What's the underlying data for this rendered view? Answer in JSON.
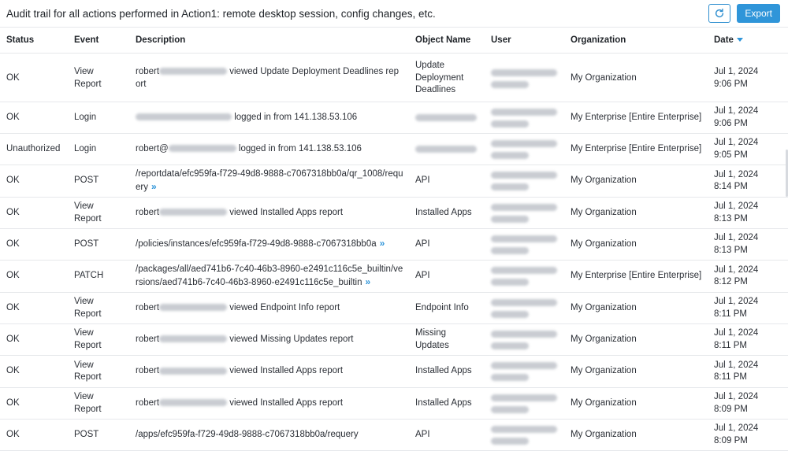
{
  "header": {
    "title": "Audit trail for all actions performed in Action1: remote desktop session, config changes, etc.",
    "export_label": "Export",
    "refresh_icon": "refresh-icon"
  },
  "columns": [
    "Status",
    "Event",
    "Description",
    "Object Name",
    "User",
    "Organization",
    "Date"
  ],
  "rows": [
    {
      "status": "OK",
      "event": [
        "View",
        "Report"
      ],
      "desc_pre": "robert",
      "desc_post": " viewed Update Deployment Deadlines report",
      "obj": [
        "Update",
        "Deployment",
        "Deadlines"
      ],
      "org": "My Organization",
      "date": [
        "Jul 1, 2024",
        "9:06 PM"
      ],
      "arrow": false
    },
    {
      "status": "OK",
      "event": [
        "Login"
      ],
      "desc_pre": "",
      "desc_post": " logged in from 141.138.53.106",
      "obj": [],
      "org": "My Enterprise [Entire Enterprise]",
      "date": [
        "Jul 1, 2024",
        "9:06 PM"
      ],
      "arrow": false
    },
    {
      "status": "Unauthorized",
      "event": [
        "Login"
      ],
      "desc_pre": "robert@",
      "desc_post": " logged in from 141.138.53.106",
      "obj": [],
      "org": "My Enterprise [Entire Enterprise]",
      "date": [
        "Jul 1, 2024",
        "9:05 PM"
      ],
      "arrow": false
    },
    {
      "status": "OK",
      "event": [
        "POST"
      ],
      "desc_pre": "/reportdata/efc959fa-f729-49d8-9888-c7067318bb0a/qr_1008/requery",
      "desc_post": "",
      "obj": [
        "API"
      ],
      "org": "My Organization",
      "date": [
        "Jul 1, 2024",
        "8:14 PM"
      ],
      "arrow": true
    },
    {
      "status": "OK",
      "event": [
        "View",
        "Report"
      ],
      "desc_pre": "robert",
      "desc_post": " viewed Installed Apps report",
      "obj": [
        "Installed Apps"
      ],
      "org": "My Organization",
      "date": [
        "Jul 1, 2024",
        "8:13 PM"
      ],
      "arrow": false
    },
    {
      "status": "OK",
      "event": [
        "POST"
      ],
      "desc_pre": "/policies/instances/efc959fa-f729-49d8-9888-c7067318bb0a",
      "desc_post": "",
      "obj": [
        "API"
      ],
      "org": "My Organization",
      "date": [
        "Jul 1, 2024",
        "8:13 PM"
      ],
      "arrow": true
    },
    {
      "status": "OK",
      "event": [
        "PATCH"
      ],
      "desc_pre": "/packages/all/aed741b6-7c40-46b3-8960-e2491c116c5e_builtin/versions/aed741b6-7c40-46b3-8960-e2491c116c5e_builtin",
      "desc_post": "",
      "obj": [
        "API"
      ],
      "org": "My Enterprise [Entire Enterprise]",
      "date": [
        "Jul 1, 2024",
        "8:12 PM"
      ],
      "arrow": true
    },
    {
      "status": "OK",
      "event": [
        "View",
        "Report"
      ],
      "desc_pre": "robert",
      "desc_post": " viewed Endpoint Info report",
      "obj": [
        "Endpoint Info"
      ],
      "org": "My Organization",
      "date": [
        "Jul 1, 2024",
        "8:11 PM"
      ],
      "arrow": false
    },
    {
      "status": "OK",
      "event": [
        "View",
        "Report"
      ],
      "desc_pre": "robert",
      "desc_post": " viewed Missing Updates report",
      "obj": [
        "Missing",
        "Updates"
      ],
      "org": "My Organization",
      "date": [
        "Jul 1, 2024",
        "8:11 PM"
      ],
      "arrow": false
    },
    {
      "status": "OK",
      "event": [
        "View",
        "Report"
      ],
      "desc_pre": "robert",
      "desc_post": " viewed Installed Apps report",
      "obj": [
        "Installed Apps"
      ],
      "org": "My Organization",
      "date": [
        "Jul 1, 2024",
        "8:11 PM"
      ],
      "arrow": false
    },
    {
      "status": "OK",
      "event": [
        "View",
        "Report"
      ],
      "desc_pre": "robert",
      "desc_post": " viewed Installed Apps report",
      "obj": [
        "Installed Apps"
      ],
      "org": "My Organization",
      "date": [
        "Jul 1, 2024",
        "8:09 PM"
      ],
      "arrow": false
    },
    {
      "status": "OK",
      "event": [
        "POST"
      ],
      "desc_pre": "/apps/efc959fa-f729-49d8-9888-c7067318bb0a/requery",
      "desc_post": "",
      "obj": [
        "API"
      ],
      "org": "My Organization",
      "date": [
        "Jul 1, 2024",
        "8:09 PM"
      ],
      "arrow": false
    }
  ],
  "colors": {
    "accent": "#2f95d9",
    "border": "#e6e8eb"
  }
}
